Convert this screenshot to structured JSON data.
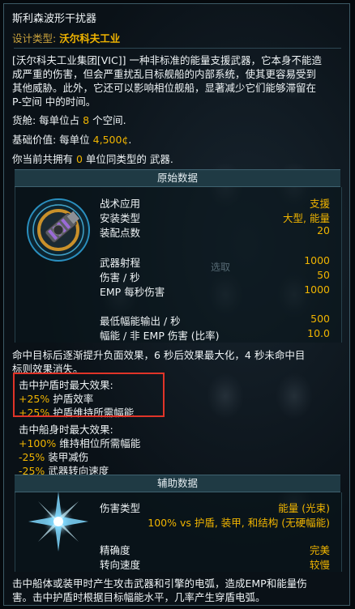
{
  "title": "斯利森波形干扰器",
  "design_type": {
    "label": "设计类型:",
    "value": "沃尔科夫工业"
  },
  "description": [
    "[沃尔科夫工业集团[VIC]] 一种非标准的能量支援武器，它本身不能造",
    "成严重的伤害，但会严重扰乱目标舰船的内部系统，使其更容易受到",
    "其他威胁。此外，它还可以影响相位舰船，显著减少它们能够滞留在",
    "P-空间 中的时间。"
  ],
  "cargo": {
    "prefix": "货舱: 每单位占 ",
    "value": "8",
    "suffix": " 个空间."
  },
  "base_value": {
    "prefix": "基础价值: 每单位 ",
    "value": "4,500¢",
    "suffix": "."
  },
  "owned": {
    "prefix": "你当前共拥有 ",
    "value": "0",
    "suffix": " 单位同类型的 武器."
  },
  "primary_header": "原始数据",
  "primary_stats": [
    {
      "label": "战术应用",
      "value": "支援"
    },
    {
      "label": "安装类型",
      "value": "大型, 能量"
    },
    {
      "label": "装配点数",
      "value": "20"
    }
  ],
  "combat_stats": [
    {
      "label": "武器射程",
      "value": "1000"
    },
    {
      "label": "伤害 / 秒",
      "value": "50"
    },
    {
      "label": "EMP 每秒伤害",
      "value": "1000"
    }
  ],
  "flux_stats": [
    {
      "label": "最低幅能输出 / 秒",
      "value": "500"
    },
    {
      "label": "幅能 / 非 EMP 伤害 (比率)",
      "value": "10.0"
    }
  ],
  "ghost_text": "选取",
  "effect_desc": [
    "命中目标后逐渐提升负面效果，6 秒后效果最大化，4 秒未命中目",
    "标则效果消失。"
  ],
  "shield_effect": {
    "title": "击中护盾时最大效果:",
    "lines": [
      {
        "value": "+25%",
        "text": " 护盾效率"
      },
      {
        "value": "+25%",
        "text": " 护盾维持所需幅能"
      }
    ]
  },
  "hull_effect": {
    "title": "击中船身时最大效果:",
    "lines": [
      {
        "value": "+100%",
        "text": " 维持相位所需幅能"
      },
      {
        "value": "-25%",
        "text": " 装甲减伤"
      },
      {
        "value": "-25%",
        "text": " 武器转向速度"
      }
    ]
  },
  "aux_header": "辅助数据",
  "damage_type": {
    "label": "伤害类型",
    "value": "能量 (光束)"
  },
  "damage_detail": {
    "value": "100%",
    "text": " vs 护盾, 装甲, 和结构 ",
    "extra": "(无硬幅能)"
  },
  "accuracy": {
    "label": "精确度",
    "value": "完美"
  },
  "turn_rate": {
    "label": "转向速度",
    "value": "较慢"
  },
  "footer": [
    "击中船体或装甲时产生攻击武器和引擎的电弧，造成EMP和能量伤",
    "害。击中护盾时根据目标幅能水平，几率产生穿盾电弧。"
  ],
  "colors": {
    "accent": "#f0b400",
    "positive": "#f0b400",
    "header_bar": "#1f3a44",
    "highlight_box": "#e03428"
  },
  "icons": {
    "weapon": "wave-disruptor-weapon-icon",
    "damage": "energy-lightning-icon"
  }
}
